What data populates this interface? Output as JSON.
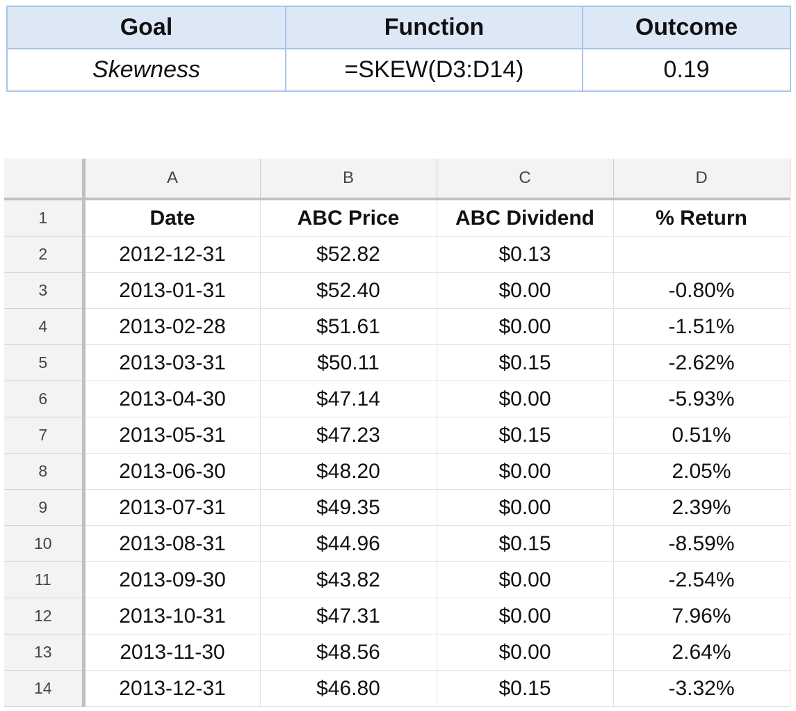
{
  "summary": {
    "headers": [
      "Goal",
      "Function",
      "Outcome"
    ],
    "row": [
      "Skewness",
      "=SKEW(D3:D14)",
      "0.19"
    ]
  },
  "sheet": {
    "column_letters": [
      "A",
      "B",
      "C",
      "D"
    ],
    "rows": [
      {
        "num": "1",
        "cells": [
          "Date",
          "ABC Price",
          "ABC Dividend",
          "% Return"
        ]
      },
      {
        "num": "2",
        "cells": [
          "2012-12-31",
          "$52.82",
          "$0.13",
          ""
        ]
      },
      {
        "num": "3",
        "cells": [
          "2013-01-31",
          "$52.40",
          "$0.00",
          "-0.80%"
        ]
      },
      {
        "num": "4",
        "cells": [
          "2013-02-28",
          "$51.61",
          "$0.00",
          "-1.51%"
        ]
      },
      {
        "num": "5",
        "cells": [
          "2013-03-31",
          "$50.11",
          "$0.15",
          "-2.62%"
        ]
      },
      {
        "num": "6",
        "cells": [
          "2013-04-30",
          "$47.14",
          "$0.00",
          "-5.93%"
        ]
      },
      {
        "num": "7",
        "cells": [
          "2013-05-31",
          "$47.23",
          "$0.15",
          "0.51%"
        ]
      },
      {
        "num": "8",
        "cells": [
          "2013-06-30",
          "$48.20",
          "$0.00",
          "2.05%"
        ]
      },
      {
        "num": "9",
        "cells": [
          "2013-07-31",
          "$49.35",
          "$0.00",
          "2.39%"
        ]
      },
      {
        "num": "10",
        "cells": [
          "2013-08-31",
          "$44.96",
          "$0.15",
          "-8.59%"
        ]
      },
      {
        "num": "11",
        "cells": [
          "2013-09-30",
          "$43.82",
          "$0.00",
          "-2.54%"
        ]
      },
      {
        "num": "12",
        "cells": [
          "2013-10-31",
          "$47.31",
          "$0.00",
          "7.96%"
        ]
      },
      {
        "num": "13",
        "cells": [
          "2013-11-30",
          "$48.56",
          "$0.00",
          "2.64%"
        ]
      },
      {
        "num": "14",
        "cells": [
          "2013-12-31",
          "$46.80",
          "$0.15",
          "-3.32%"
        ]
      }
    ]
  }
}
